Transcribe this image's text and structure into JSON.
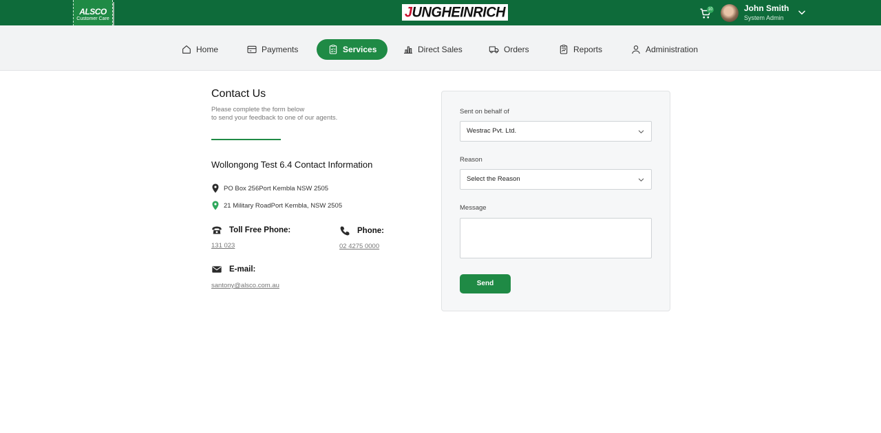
{
  "header": {
    "brand_name": "ALSCO",
    "brand_subtitle": "Customer Care",
    "center_logo": "JUNGHEINRICH",
    "cart_count": "10",
    "user_name": "John Smith",
    "user_role": "System Admin"
  },
  "nav": {
    "home": "Home",
    "payments": "Payments",
    "services": "Services",
    "direct_sales": "Direct Sales",
    "orders": "Orders",
    "reports": "Reports",
    "administration": "Administration",
    "active": "Services"
  },
  "contact": {
    "title": "Contact Us",
    "subtitle_line1": "Please complete the form below",
    "subtitle_line2": "to send your feedback to one of our agents.",
    "info_title": "Wollongong Test 6.4 Contact Information",
    "postal_address": "PO Box 256Port Kembla NSW 2505",
    "street_address": "21 Military RoadPort Kembla, NSW 2505",
    "toll_free_label": "Toll Free Phone:",
    "toll_free_value": "131 023",
    "phone_label": "Phone:",
    "phone_value": "02 4275 0000",
    "email_label": "E-mail:",
    "email_value": "santony@alsco.com.au"
  },
  "form": {
    "behalf_label": "Sent on behalf of",
    "behalf_value": "Westrac Pvt. Ltd.",
    "reason_label": "Reason",
    "reason_value": "Select the Reason",
    "message_label": "Message",
    "message_value": "",
    "send_label": "Send"
  },
  "colors": {
    "brand_green": "#0e6b3a",
    "accent_green": "#1f8a45"
  }
}
